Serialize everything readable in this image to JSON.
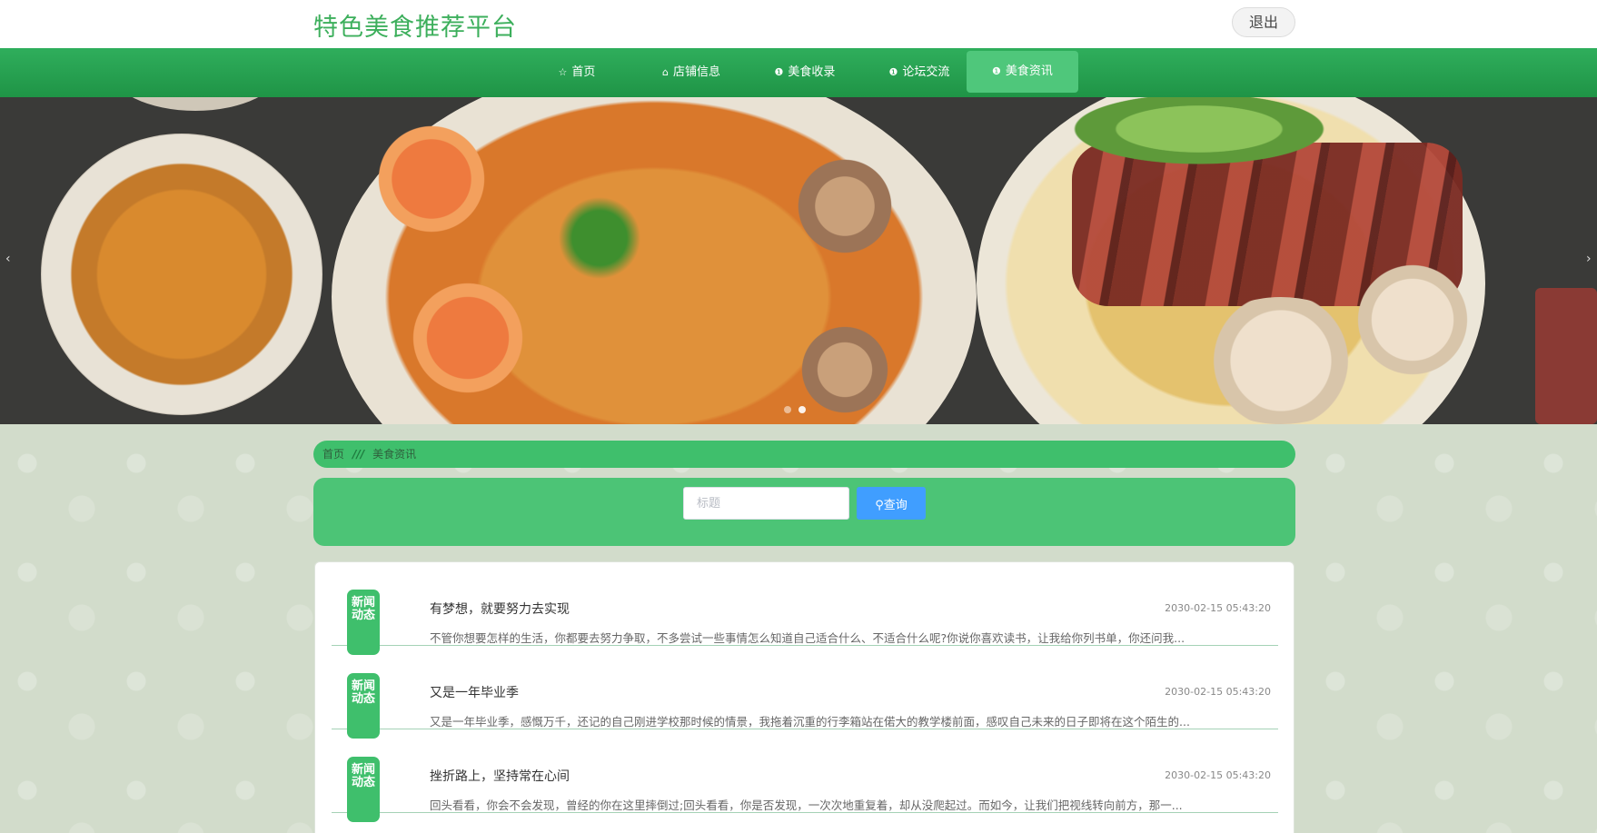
{
  "header": {
    "title": "特色美食推荐平台",
    "logout_label": "退出"
  },
  "nav": {
    "items": [
      {
        "label": "首页",
        "icon": "star-icon"
      },
      {
        "label": "店铺信息",
        "icon": "shop-icon"
      },
      {
        "label": "美食收录",
        "icon": "info-icon"
      },
      {
        "label": "论坛交流",
        "icon": "info-icon"
      },
      {
        "label": "美食资讯",
        "icon": "info-icon",
        "active": true
      }
    ]
  },
  "breadcrumb": {
    "home": "首页",
    "separator": "///",
    "current": "美食资讯"
  },
  "search": {
    "placeholder": "标题",
    "button_label": "查询"
  },
  "news": [
    {
      "badge": "新闻动态",
      "title": "有梦想，就要努力去实现",
      "date": "2030-02-15 05:43:20",
      "summary": "不管你想要怎样的生活，你都要去努力争取，不多尝试一些事情怎么知道自己适合什么、不适合什么呢?你说你喜欢读书，让我给你列书单，你还问我..."
    },
    {
      "badge": "新闻动态",
      "title": "又是一年毕业季",
      "date": "2030-02-15 05:43:20",
      "summary": "又是一年毕业季，感慨万千，还记的自己刚进学校那时候的情景，我拖着沉重的行李箱站在偌大的教学楼前面，感叹自己未来的日子即将在这个陌生的..."
    },
    {
      "badge": "新闻动态",
      "title": "挫折路上，坚持常在心间",
      "date": "2030-02-15 05:43:20",
      "summary": "回头看看，你会不会发现，曾经的你在这里摔倒过;回头看看，你是否发现，一次次地重复着，却从没爬起过。而如今，让我们把视线转向前方，那一..."
    }
  ],
  "colors": {
    "brand_green": "#3daf5c",
    "nav_green": "#1f9446",
    "accent_blue": "#409eff"
  }
}
